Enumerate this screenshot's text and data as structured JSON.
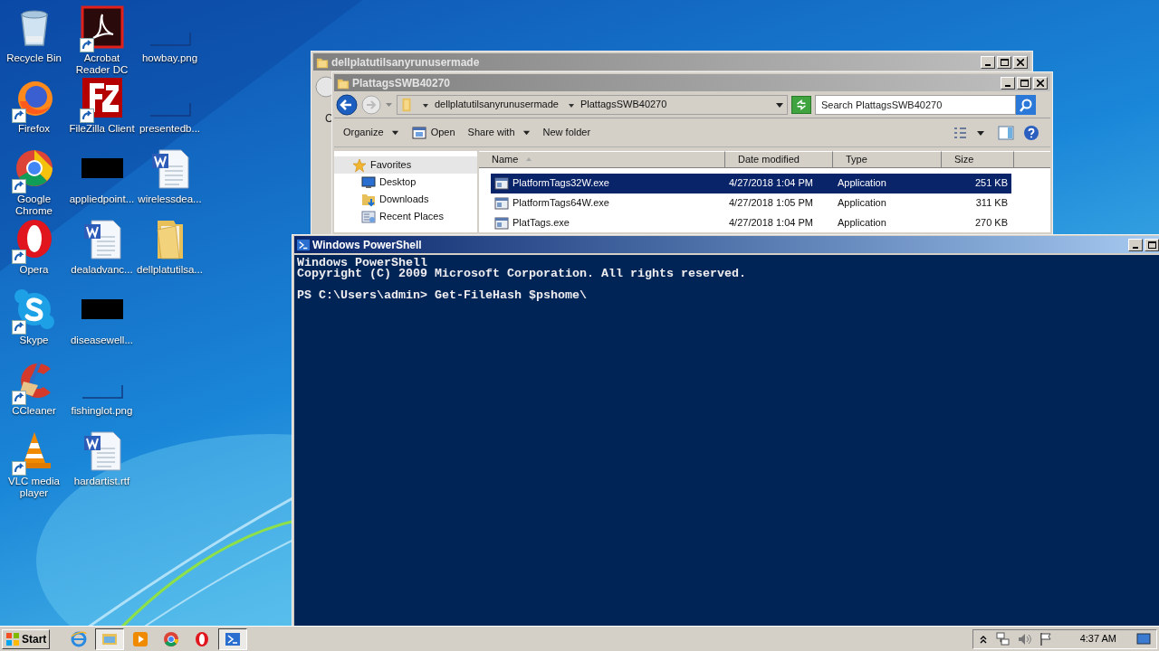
{
  "desktop_icons": [
    {
      "label": "Recycle Bin",
      "kind": "recycle",
      "shortcut": false
    },
    {
      "label": "Firefox",
      "kind": "firefox",
      "shortcut": true
    },
    {
      "label": "Google Chrome",
      "kind": "chrome",
      "shortcut": true
    },
    {
      "label": "Opera",
      "kind": "opera",
      "shortcut": true
    },
    {
      "label": "Skype",
      "kind": "skype",
      "shortcut": true
    },
    {
      "label": "CCleaner",
      "kind": "ccleaner",
      "shortcut": true
    },
    {
      "label": "VLC media player",
      "kind": "vlc",
      "shortcut": true
    },
    {
      "label": "Acrobat Reader DC",
      "kind": "acrobat",
      "shortcut": true
    },
    {
      "label": "FileZilla Client",
      "kind": "filezilla",
      "shortcut": true
    },
    {
      "label": "appliedpoint...",
      "kind": "dark_thumb",
      "shortcut": false
    },
    {
      "label": "dealadvanc...",
      "kind": "word",
      "shortcut": false
    },
    {
      "label": "diseasewell...",
      "kind": "dark_thumb",
      "shortcut": false
    },
    {
      "label": "fishinglot.png",
      "kind": "blank_thumb",
      "shortcut": false
    },
    {
      "label": "hardartist.rtf",
      "kind": "word",
      "shortcut": false
    },
    {
      "label": "howbay.png",
      "kind": "blank_thumb",
      "shortcut": false
    },
    {
      "label": "presentedb...",
      "kind": "blank_thumb",
      "shortcut": false
    },
    {
      "label": "wirelessdea...",
      "kind": "word",
      "shortcut": false
    },
    {
      "label": "dellplatutilsa...",
      "kind": "folder",
      "shortcut": false
    }
  ],
  "back_window": {
    "title": "dellplatutilsanyrunusermade",
    "active": false,
    "toolbar_partial": "C"
  },
  "explorer": {
    "title": "PlattagsSWB40270",
    "active": false,
    "breadcrumb": [
      "dellplatutilsanyrunusermade",
      "PlattagsSWB40270"
    ],
    "search": {
      "placeholder": "Search PlattagsSWB40270"
    },
    "toolbar": [
      {
        "label": "Organize",
        "kind": "menu"
      },
      {
        "label": "Open",
        "kind": "open"
      },
      {
        "label": "Share with",
        "kind": "menu"
      },
      {
        "label": "New folder",
        "kind": "plain"
      }
    ],
    "nav": [
      {
        "label": "Favorites",
        "kind": "favorites"
      },
      {
        "label": "Desktop",
        "kind": "desktop"
      },
      {
        "label": "Downloads",
        "kind": "downloads"
      },
      {
        "label": "Recent Places",
        "kind": "recent"
      }
    ],
    "columns": [
      "Name",
      "Date modified",
      "Type",
      "Size"
    ],
    "rows": [
      {
        "name": "PlatformTags32W.exe",
        "date": "4/27/2018 1:04 PM",
        "type": "Application",
        "size": "251 KB",
        "selected": true
      },
      {
        "name": "PlatformTags64W.exe",
        "date": "4/27/2018 1:05 PM",
        "type": "Application",
        "size": "311 KB",
        "selected": false
      },
      {
        "name": "PlatTags.exe",
        "date": "4/27/2018 1:04 PM",
        "type": "Application",
        "size": "270 KB",
        "selected": false
      }
    ]
  },
  "powershell": {
    "title": "Windows PowerShell",
    "active": true,
    "output_blocks": [
      [
        "Windows PowerShell",
        "Copyright (C) 2009 Microsoft Corporation. All rights reserved."
      ],
      [
        "PS C:\\Users\\admin> Get-FileHash $pshome\\"
      ]
    ]
  },
  "taskbar": {
    "start": "Start",
    "buttons": [
      {
        "kind": "ie",
        "pressed": false
      },
      {
        "kind": "explorer",
        "pressed": true
      },
      {
        "kind": "media",
        "pressed": false
      },
      {
        "kind": "chrome",
        "pressed": false
      },
      {
        "kind": "opera",
        "pressed": false
      },
      {
        "kind": "powershell",
        "pressed": true
      }
    ],
    "clock": "4:37 AM"
  }
}
